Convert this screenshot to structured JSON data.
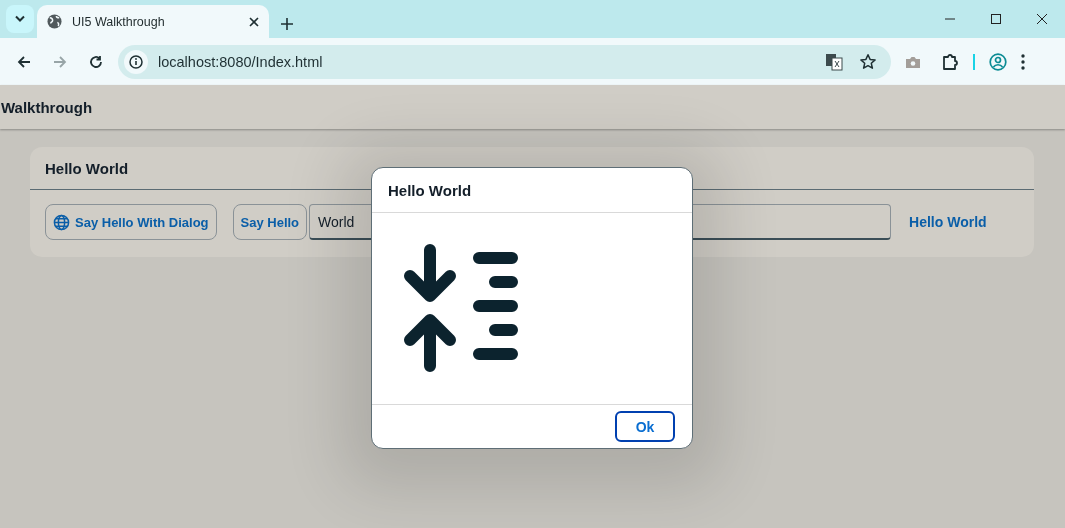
{
  "browser": {
    "tab": {
      "title": "UI5 Walkthrough"
    },
    "address": "localhost:8080/Index.html"
  },
  "app": {
    "title": "Walkthrough"
  },
  "panel": {
    "title": "Hello World",
    "buttons": [
      {
        "label": "Say Hello With Dialog"
      },
      {
        "label": "Say Hello"
      }
    ],
    "input": {
      "value": "World"
    },
    "link": "Hello World"
  },
  "dialog": {
    "title": "Hello World",
    "buttons": [
      "Ok"
    ]
  }
}
